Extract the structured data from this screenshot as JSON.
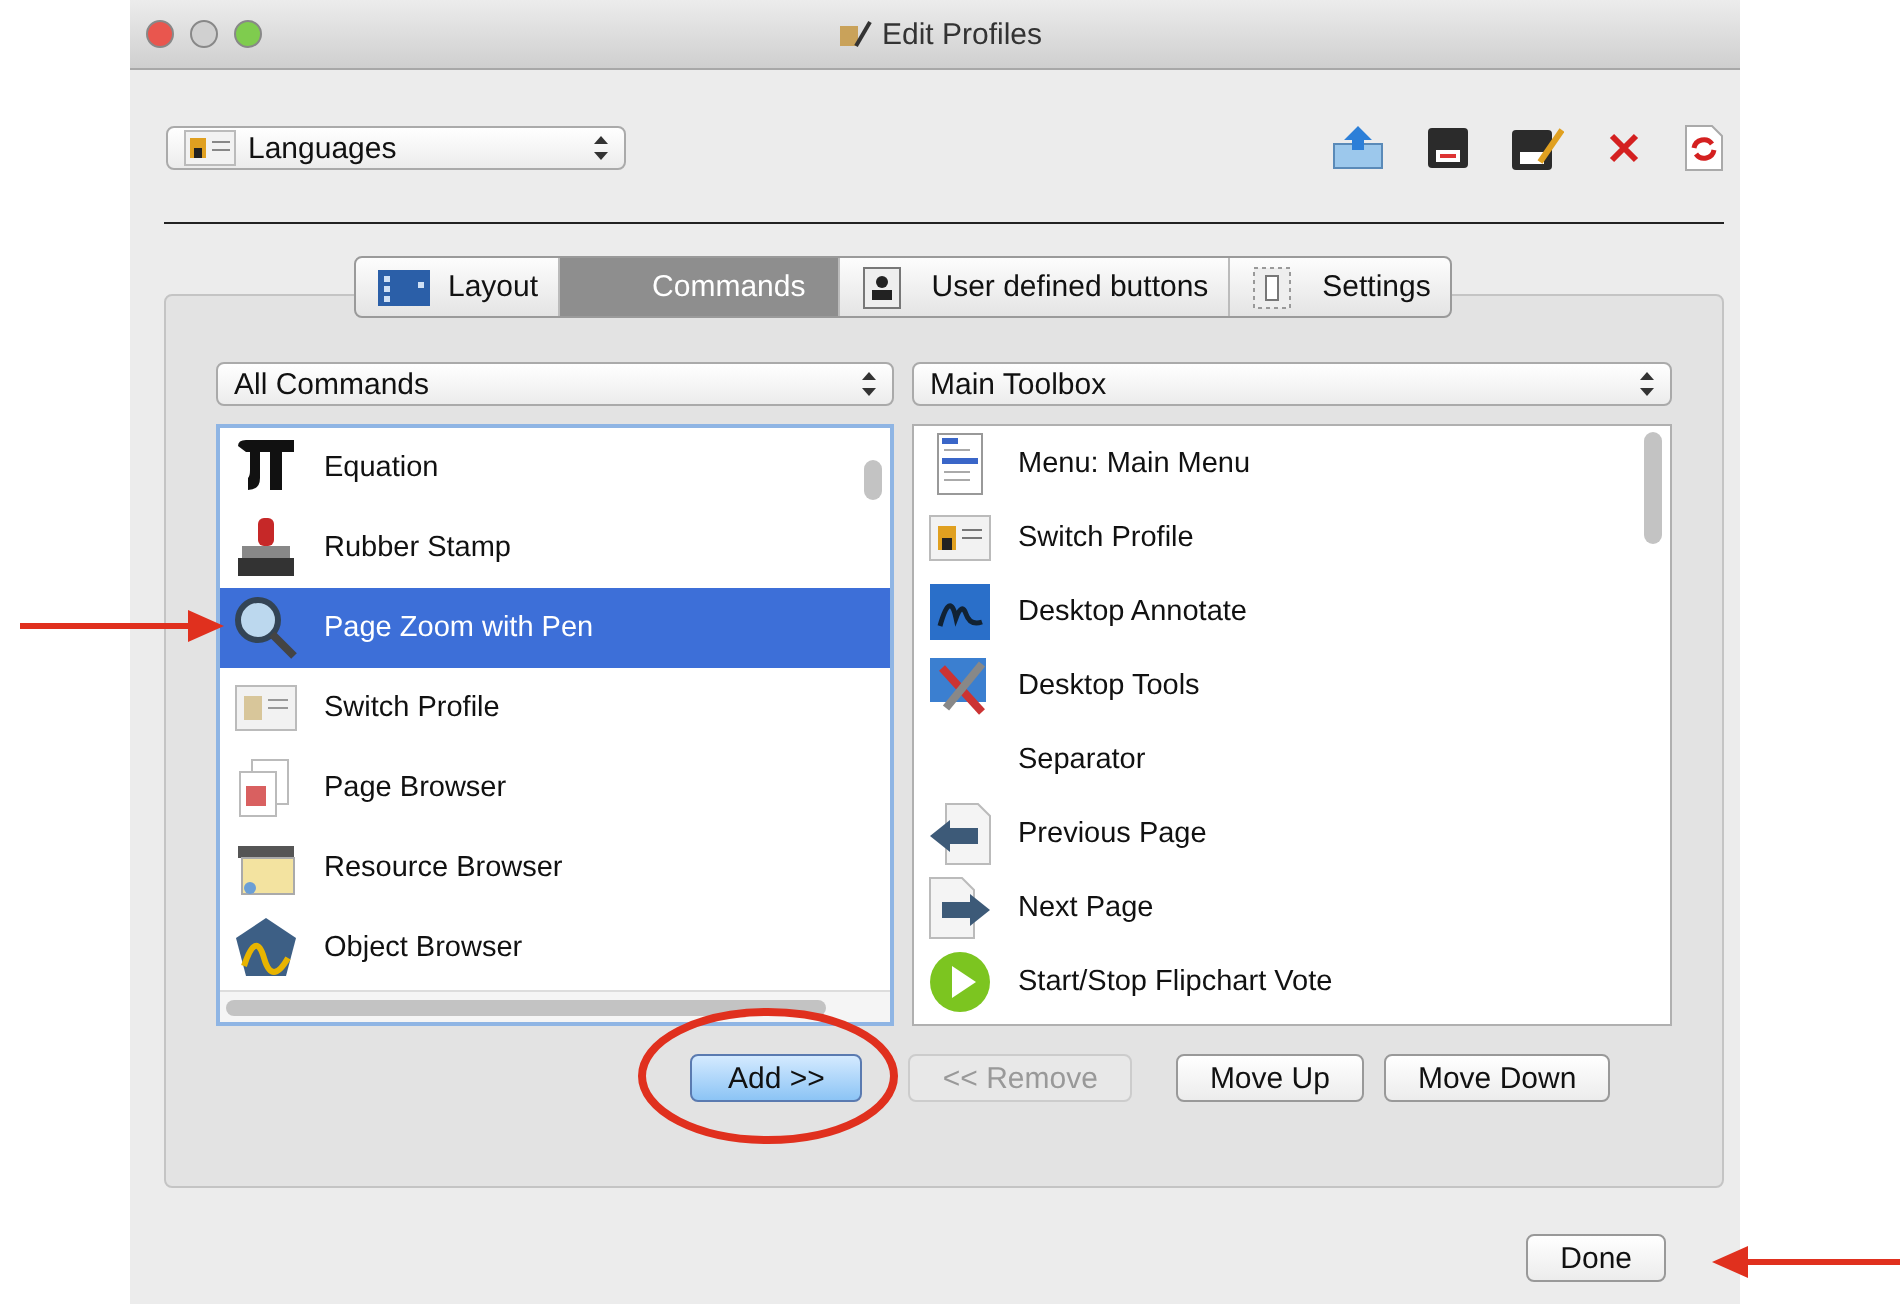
{
  "window": {
    "title": "Edit Profiles"
  },
  "profile_select": {
    "value": "Languages"
  },
  "tabs": [
    {
      "label": "Layout",
      "selected": false
    },
    {
      "label": "Commands",
      "selected": true
    },
    {
      "label": "User defined buttons",
      "selected": false
    },
    {
      "label": "Settings",
      "selected": false
    }
  ],
  "left_select": {
    "value": "All Commands"
  },
  "right_select": {
    "value": "Main Toolbox"
  },
  "left_list": [
    {
      "label": "Equation",
      "selected": false
    },
    {
      "label": "Rubber Stamp",
      "selected": false
    },
    {
      "label": "Page Zoom with Pen",
      "selected": true
    },
    {
      "label": "Switch Profile",
      "selected": false
    },
    {
      "label": "Page Browser",
      "selected": false
    },
    {
      "label": "Resource Browser",
      "selected": false
    },
    {
      "label": "Object Browser",
      "selected": false
    }
  ],
  "right_list": [
    {
      "label": "Menu: Main Menu",
      "selected": false
    },
    {
      "label": "Switch Profile",
      "selected": false
    },
    {
      "label": "Desktop Annotate",
      "selected": false
    },
    {
      "label": "Desktop Tools",
      "selected": false
    },
    {
      "label": "Separator",
      "selected": false
    },
    {
      "label": "Previous Page",
      "selected": false
    },
    {
      "label": "Next Page",
      "selected": false
    },
    {
      "label": "Start/Stop Flipchart Vote",
      "selected": false
    }
  ],
  "buttons": [
    {
      "label": "Add >>",
      "default": true,
      "disabled": false
    },
    {
      "label": "<< Remove",
      "default": false,
      "disabled": true
    },
    {
      "label": "Move Up",
      "default": false,
      "disabled": false
    },
    {
      "label": "Move Down",
      "default": false,
      "disabled": false
    }
  ],
  "done_button": {
    "label": "Done"
  }
}
